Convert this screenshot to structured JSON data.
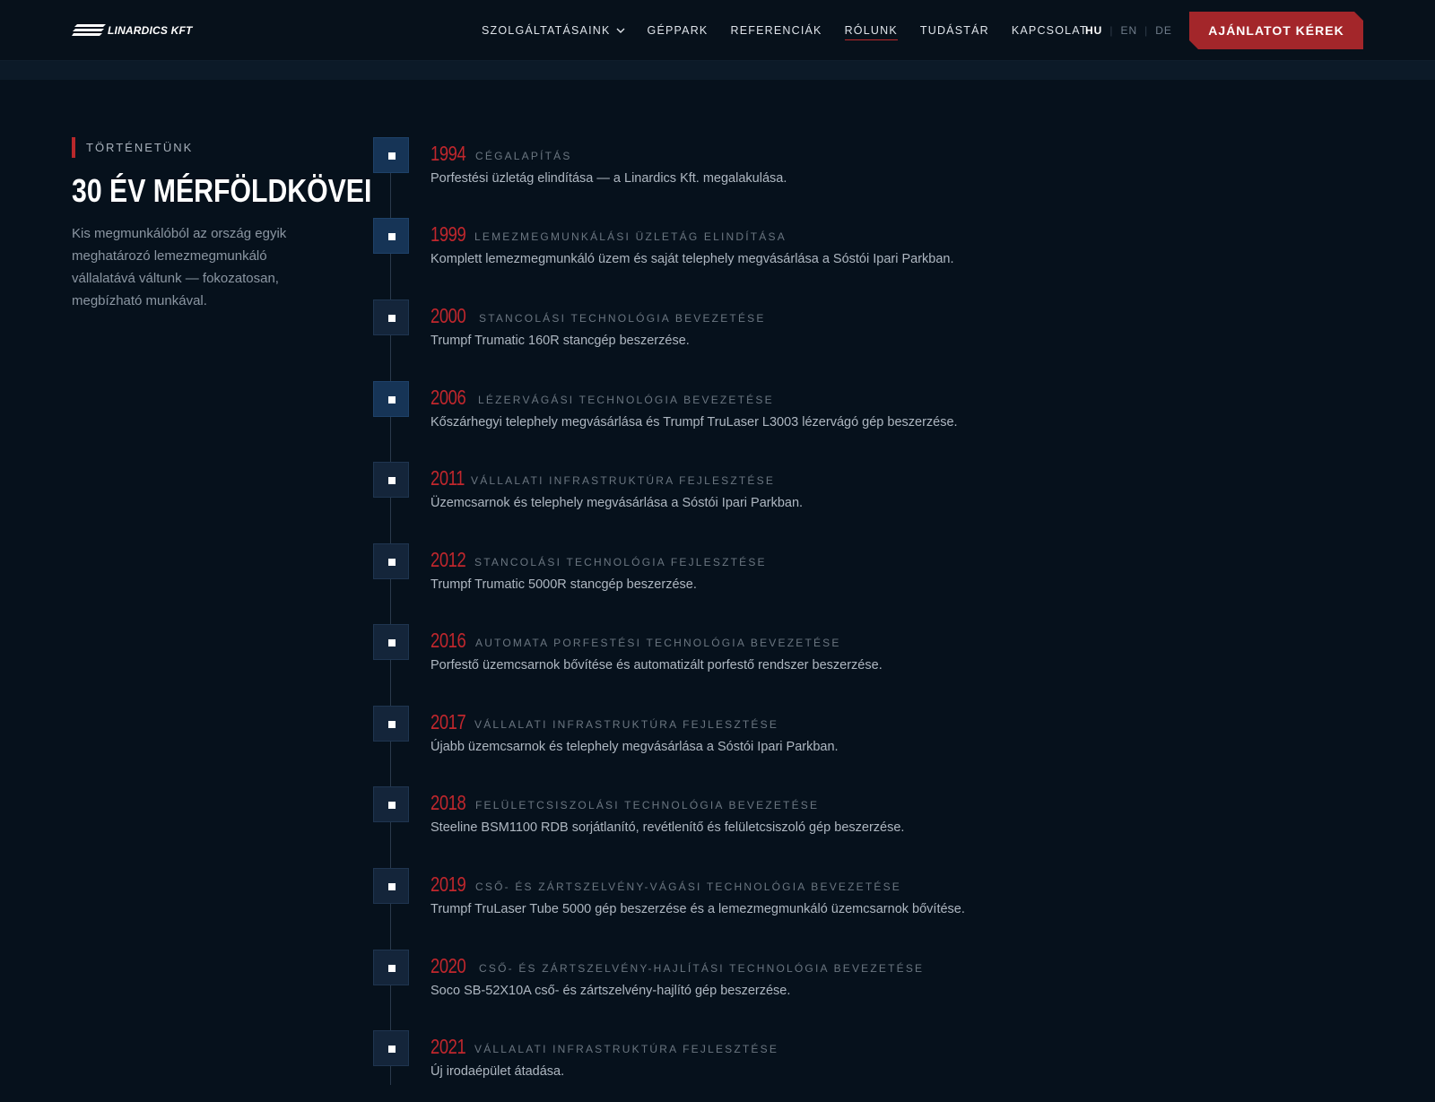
{
  "header": {
    "logo_text": "LINARDICS KFT",
    "nav": [
      {
        "label": "SZOLGÁLTATÁSAINK",
        "has_dropdown": true
      },
      {
        "label": "GÉPPARK"
      },
      {
        "label": "REFERENCIÁK"
      },
      {
        "label": "RÓLUNK",
        "active": true
      },
      {
        "label": "TUDÁSTÁR"
      },
      {
        "label": "KAPCSOLAT"
      }
    ],
    "languages": [
      {
        "code": "HU",
        "active": true
      },
      {
        "code": "EN"
      },
      {
        "code": "DE"
      }
    ],
    "cta_label": "AJÁNLATOT KÉREK"
  },
  "intro": {
    "eyebrow": "TÖRTÉNETÜNK",
    "title": "30 ÉV MÉRFÖLDKÖVEI",
    "text": "Kis megmunkálóból az ország egyik meghatározó lemezmegmunkáló vállalatává váltunk — fokozatosan, megbízható munkával."
  },
  "timeline": [
    {
      "year": "1994",
      "tag": "CÉGALAPÍTÁS",
      "desc": "Porfestési üzletág elindítása — a Linardics Kft. megalakulása."
    },
    {
      "year": "1999",
      "tag": "LEMEZMEGMUNKÁLÁSI ÜZLETÁG ELINDÍTÁSA",
      "desc": "Komplett lemezmegmunkáló üzem és saját telephely megvásárlása a Sóstói Ipari Parkban."
    },
    {
      "year": "2000",
      "tag": "STANCOLÁSI TECHNOLÓGIA BEVEZETÉSE",
      "desc": "Trumpf Trumatic 160R stancgép beszerzése."
    },
    {
      "year": "2006",
      "tag": "LÉZERVÁGÁSI TECHNOLÓGIA BEVEZETÉSE",
      "desc": "Kőszárhegyi telephely megvásárlása és Trumpf TruLaser L3003 lézervágó gép beszerzése."
    },
    {
      "year": "2011",
      "tag": "VÁLLALATI INFRASTRUKTÚRA FEJLESZTÉSE",
      "desc": "Üzemcsarnok és telephely megvásárlása a Sóstói Ipari Parkban."
    },
    {
      "year": "2012",
      "tag": "STANCOLÁSI TECHNOLÓGIA FEJLESZTÉSE",
      "desc": "Trumpf Trumatic 5000R stancgép beszerzése."
    },
    {
      "year": "2016",
      "tag": "AUTOMATA PORFESTÉSI TECHNOLÓGIA BEVEZETÉSE",
      "desc": "Porfestő üzemcsarnok bővítése és automatizált porfestő rendszer beszerzése."
    },
    {
      "year": "2017",
      "tag": "VÁLLALATI INFRASTRUKTÚRA FEJLESZTÉSE",
      "desc": "Újabb üzemcsarnok és telephely megvásárlása a Sóstói Ipari Parkban."
    },
    {
      "year": "2018",
      "tag": "FELÜLETCSISZOLÁSI TECHNOLÓGIA BEVEZETÉSE",
      "desc": "Steeline BSM1100 RDB sorjátlanító, revétlenítő és felületcsiszoló gép beszerzése."
    },
    {
      "year": "2019",
      "tag": "CSŐ- ÉS ZÁRTSZELVÉNY-VÁGÁSI TECHNOLÓGIA BEVEZETÉSE",
      "desc": "Trumpf TruLaser Tube 5000 gép beszerzése és a lemezmegmunkáló üzemcsarnok bővítése."
    },
    {
      "year": "2020",
      "tag": "CSŐ- ÉS ZÁRTSZELVÉNY-HAJLÍTÁSI TECHNOLÓGIA BEVEZETÉSE",
      "desc": "Soco SB-52X10A cső- és zártszelvény-hajlító gép beszerzése."
    },
    {
      "year": "2021",
      "tag": "VÁLLALATI INFRASTRUKTÚRA FEJLESZTÉSE",
      "desc": "Új irodaépület átadása."
    }
  ]
}
